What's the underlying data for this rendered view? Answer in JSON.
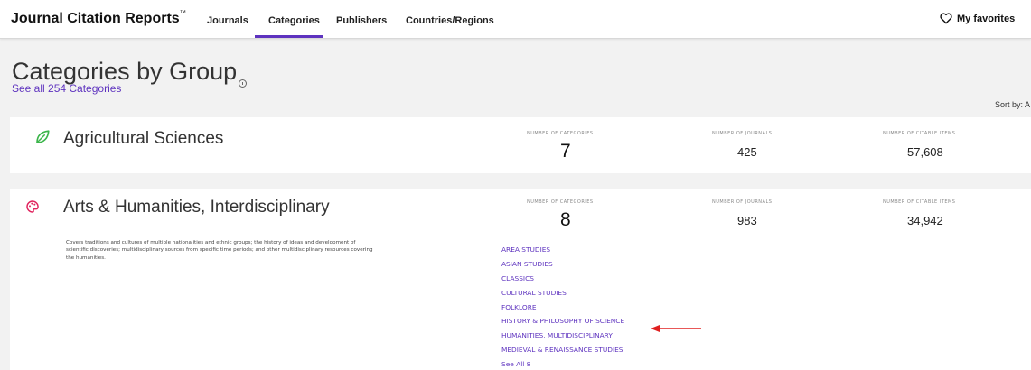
{
  "nav": {
    "brand": "Journal Citation Reports",
    "brand_mark": "™",
    "tabs": [
      "Journals",
      "Categories",
      "Publishers",
      "Countries/Regions"
    ],
    "active_tab": "Categories",
    "favorites_label": "My favorites"
  },
  "header": {
    "title": "Categories by Group",
    "see_all_link": "See all 254 Categories",
    "sort_by": "Sort by: A"
  },
  "groups": [
    {
      "name": "Agricultural Sciences",
      "icon": "leaf-icon",
      "icon_color": "#3bb54a",
      "num_categories_label": "NUMBER OF CATEGORIES",
      "num_categories": "7",
      "num_journals_label": "NUMBER OF JOURNALS",
      "num_journals": "425",
      "num_citable_label": "NUMBER OF CITABLE ITEMS",
      "num_citable": "57,608"
    },
    {
      "name": "Arts & Humanities, Interdisciplinary",
      "icon": "palette-icon",
      "icon_color": "#e0245e",
      "num_categories_label": "NUMBER OF CATEGORIES",
      "num_categories": "8",
      "num_journals_label": "NUMBER OF JOURNALS",
      "num_journals": "983",
      "num_citable_label": "NUMBER OF CITABLE ITEMS",
      "num_citable": "34,942",
      "description": "Covers traditions and cultures of multiple nationalities and ethnic groups; the history of ideas and development of scientific discoveries; multidisciplinary sources from specific time periods; and other multidisciplinary resources covering the humanities.",
      "categories": [
        "AREA STUDIES",
        "ASIAN STUDIES",
        "CLASSICS",
        "CULTURAL STUDIES",
        "FOLKLORE",
        "HISTORY & PHILOSOPHY OF SCIENCE",
        "HUMANITIES, MULTIDISCIPLINARY",
        "MEDIEVAL & RENAISSANCE STUDIES"
      ],
      "see_all": "See All 8"
    }
  ],
  "colors": {
    "accent": "#5e33bf",
    "annotation_arrow": "#e02020"
  }
}
